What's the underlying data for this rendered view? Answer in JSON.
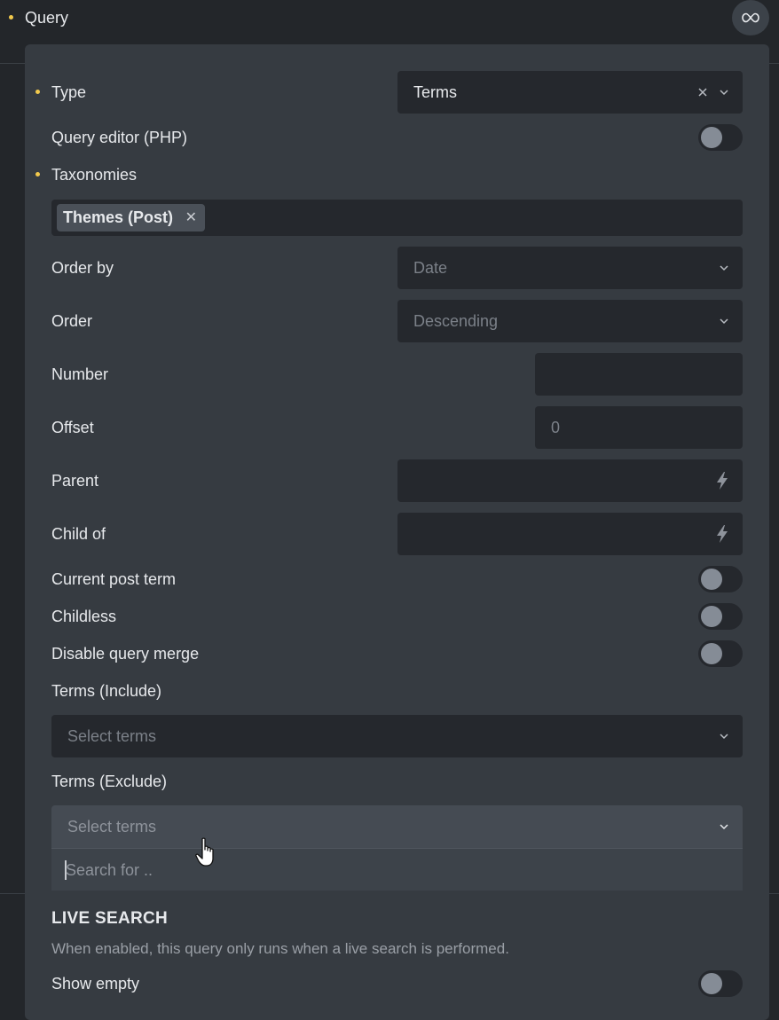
{
  "header": {
    "title": "Query",
    "infinite_icon": "infinity-icon"
  },
  "fields": {
    "type": {
      "label": "Type",
      "value": "Terms"
    },
    "query_editor": {
      "label": "Query editor (PHP)"
    },
    "taxonomies": {
      "label": "Taxonomies",
      "chip": "Themes (Post)"
    },
    "order_by": {
      "label": "Order by",
      "placeholder": "Date"
    },
    "order": {
      "label": "Order",
      "placeholder": "Descending"
    },
    "number": {
      "label": "Number",
      "value": ""
    },
    "offset": {
      "label": "Offset",
      "placeholder": "0"
    },
    "parent": {
      "label": "Parent"
    },
    "child_of": {
      "label": "Child of"
    },
    "current_post_term": {
      "label": "Current post term"
    },
    "childless": {
      "label": "Childless"
    },
    "disable_query_merge": {
      "label": "Disable query merge"
    },
    "terms_include": {
      "label": "Terms (Include)",
      "placeholder": "Select terms"
    },
    "terms_exclude": {
      "label": "Terms (Exclude)",
      "placeholder": "Select terms",
      "search_placeholder": "Search for .."
    }
  },
  "live_search": {
    "title": "LIVE SEARCH",
    "description": "When enabled, this query only runs when a live search is performed.",
    "show_empty_label": "Show empty"
  },
  "colors": {
    "accent_dot": "#f2c94c",
    "panel": "#363b41",
    "field": "#25282d"
  }
}
